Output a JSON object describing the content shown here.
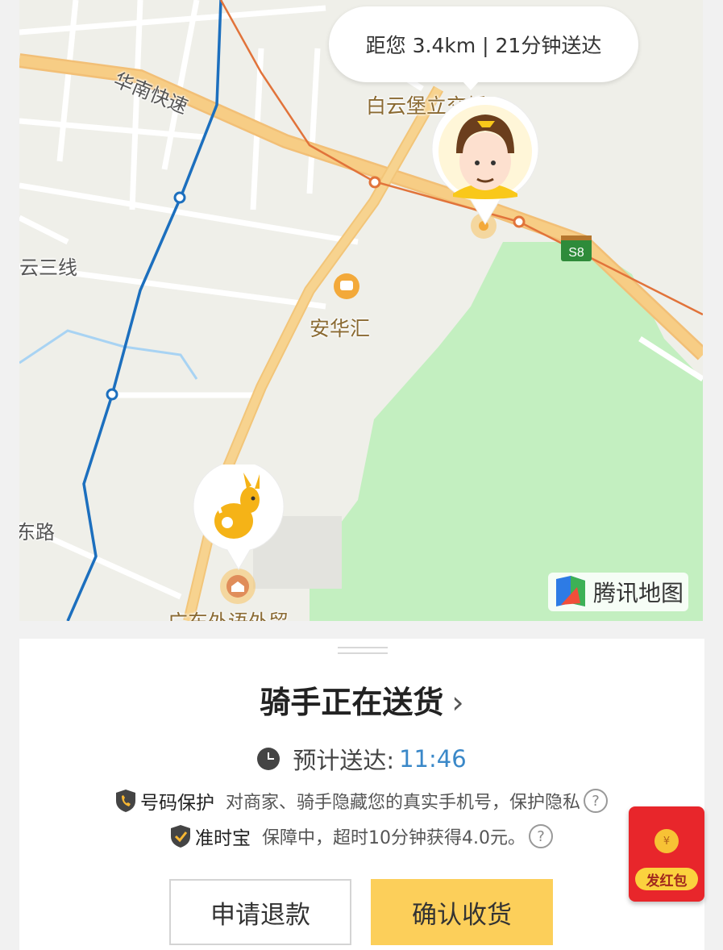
{
  "map": {
    "eta_text": "距您 3.4km | 21分钟送达",
    "labels": {
      "expressway": "华南快速",
      "poi_top": "白云堡立交桥",
      "road_left": "云三线",
      "poi_mid": "安华汇",
      "road_bottom_left": "东路",
      "poi_bottom": "广东外语外贸"
    },
    "highway_shield": "S8",
    "logo_text": "腾讯地图",
    "colors": {
      "road_major": "#f7cd85",
      "water": "#a8d3f3",
      "park": "#c3efc0",
      "metro_blue": "#1c6fbe",
      "metro_orange": "#e1733a"
    }
  },
  "sheet": {
    "status_title": "骑手正在送货",
    "status_chevron": "›",
    "eta_label": "预计送达:",
    "eta_time": "11:46",
    "number_protect": {
      "name": "号码保护",
      "desc": "对商家、骑手隐藏您的真实手机号，保护隐私",
      "help": "?"
    },
    "ontime": {
      "name": "准时宝",
      "desc": "保障中，超时10分钟获得4.0元。",
      "help": "?"
    },
    "refund_button": "申请退款",
    "confirm_button": "确认收货"
  },
  "red_packet": {
    "coin_text": "¥",
    "label": "发红包"
  }
}
